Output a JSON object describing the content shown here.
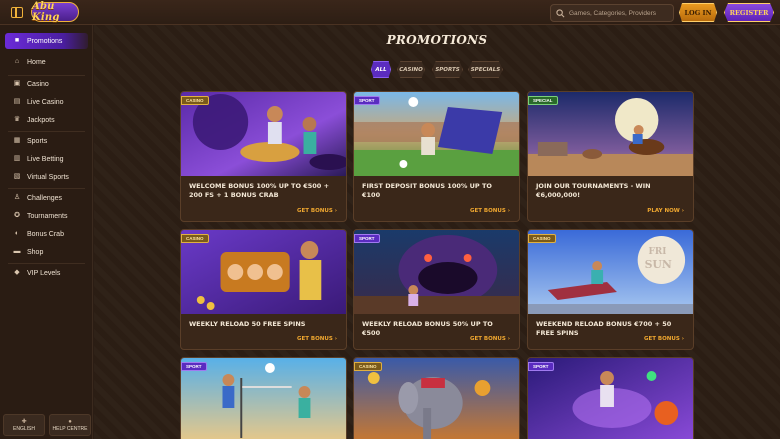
{
  "header": {
    "logo_text": "Abu King",
    "search_placeholder": "Games, Categories, Providers",
    "login_label": "LOG IN",
    "register_label": "REGISTER"
  },
  "sidebar": {
    "items": [
      {
        "label": "Promotions",
        "icon": "gift-icon",
        "active": true
      },
      {
        "label": "Home",
        "icon": "home-icon"
      },
      {
        "label": "Casino",
        "icon": "slot-machine-icon"
      },
      {
        "label": "Live Casino",
        "icon": "cards-icon"
      },
      {
        "label": "Jackpots",
        "icon": "trophy-icon"
      },
      {
        "label": "Sports",
        "icon": "sports-icon"
      },
      {
        "label": "Live Betting",
        "icon": "live-icon"
      },
      {
        "label": "Virtual Sports",
        "icon": "virtual-icon"
      },
      {
        "label": "Challenges",
        "icon": "medal-icon"
      },
      {
        "label": "Tournaments",
        "icon": "tournament-icon"
      },
      {
        "label": "Bonus Crab",
        "icon": "crab-icon"
      },
      {
        "label": "Shop",
        "icon": "shop-icon"
      },
      {
        "label": "VIP Levels",
        "icon": "diamond-icon"
      }
    ],
    "footer": {
      "language_label": "ENGLISH",
      "help_label": "HELP CENTRE"
    }
  },
  "main": {
    "title": "PROMOTIONS",
    "filters": [
      {
        "label": "ALL",
        "active": true
      },
      {
        "label": "CASINO"
      },
      {
        "label": "SPORTS"
      },
      {
        "label": "SPECIALS"
      }
    ],
    "cards": [
      {
        "tag": "CASINO",
        "tag_type": "casino",
        "title": "WELCOME BONUS 100% UP TO €500 + 200 FS + 1 BONUS CRAB",
        "cta": "GET BONUS ›"
      },
      {
        "tag": "SPORT",
        "tag_type": "sport",
        "title": "FIRST DEPOSIT BONUS 100% UP TO €100",
        "cta": "GET BONUS ›"
      },
      {
        "tag": "SPECIAL",
        "tag_type": "special",
        "title": "JOIN OUR TOURNAMENTS - WIN €6,000,000!",
        "cta": "PLAY NOW ›"
      },
      {
        "tag": "CASINO",
        "tag_type": "casino",
        "title": "WEEKLY RELOAD 50 FREE SPINS",
        "cta": "GET BONUS ›"
      },
      {
        "tag": "SPORT",
        "tag_type": "sport",
        "title": "WEEKLY RELOAD BONUS 50% UP TO €500",
        "cta": "GET BONUS ›"
      },
      {
        "tag": "CASINO",
        "tag_type": "casino",
        "title": "WEEKEND RELOAD BONUS €700 + 50 FREE SPINS",
        "cta": "GET BONUS ›"
      },
      {
        "tag": "SPORT",
        "tag_type": "sport",
        "title": "",
        "cta": ""
      },
      {
        "tag": "CASINO",
        "tag_type": "casino",
        "title": "",
        "cta": ""
      },
      {
        "tag": "SPORT",
        "tag_type": "sport",
        "title": "",
        "cta": ""
      }
    ]
  }
}
